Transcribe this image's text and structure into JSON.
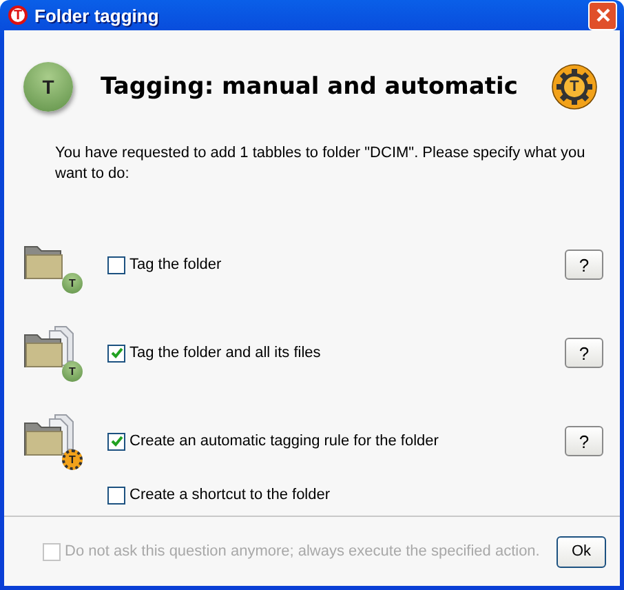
{
  "window": {
    "title": "Folder tagging",
    "app_letter": "T"
  },
  "header": {
    "title": "Tagging: manual and automatic",
    "left_letter": "T",
    "right_letter": "T"
  },
  "message": "You have requested to add 1 tabbles to folder \"DCIM\". Please specify what you want to do:",
  "options": [
    {
      "kind": "folder",
      "badge_letter": "T",
      "label": "Tag the folder",
      "checked": false,
      "help": "?"
    },
    {
      "kind": "folder-files",
      "badge_letter": "T",
      "label": "Tag the folder and all its files",
      "checked": true,
      "help": "?"
    },
    {
      "kind": "folder-gear",
      "badge_letter": "T",
      "label": "Create an automatic tagging rule for the folder",
      "checked": true,
      "help": "?"
    },
    {
      "kind": "plain",
      "label": "Create a shortcut to the folder",
      "checked": false
    }
  ],
  "footer": {
    "dont_ask": {
      "label": "Do not ask this question anymore; always execute the specified action.",
      "checked": false,
      "disabled": true
    },
    "ok": "Ok"
  }
}
